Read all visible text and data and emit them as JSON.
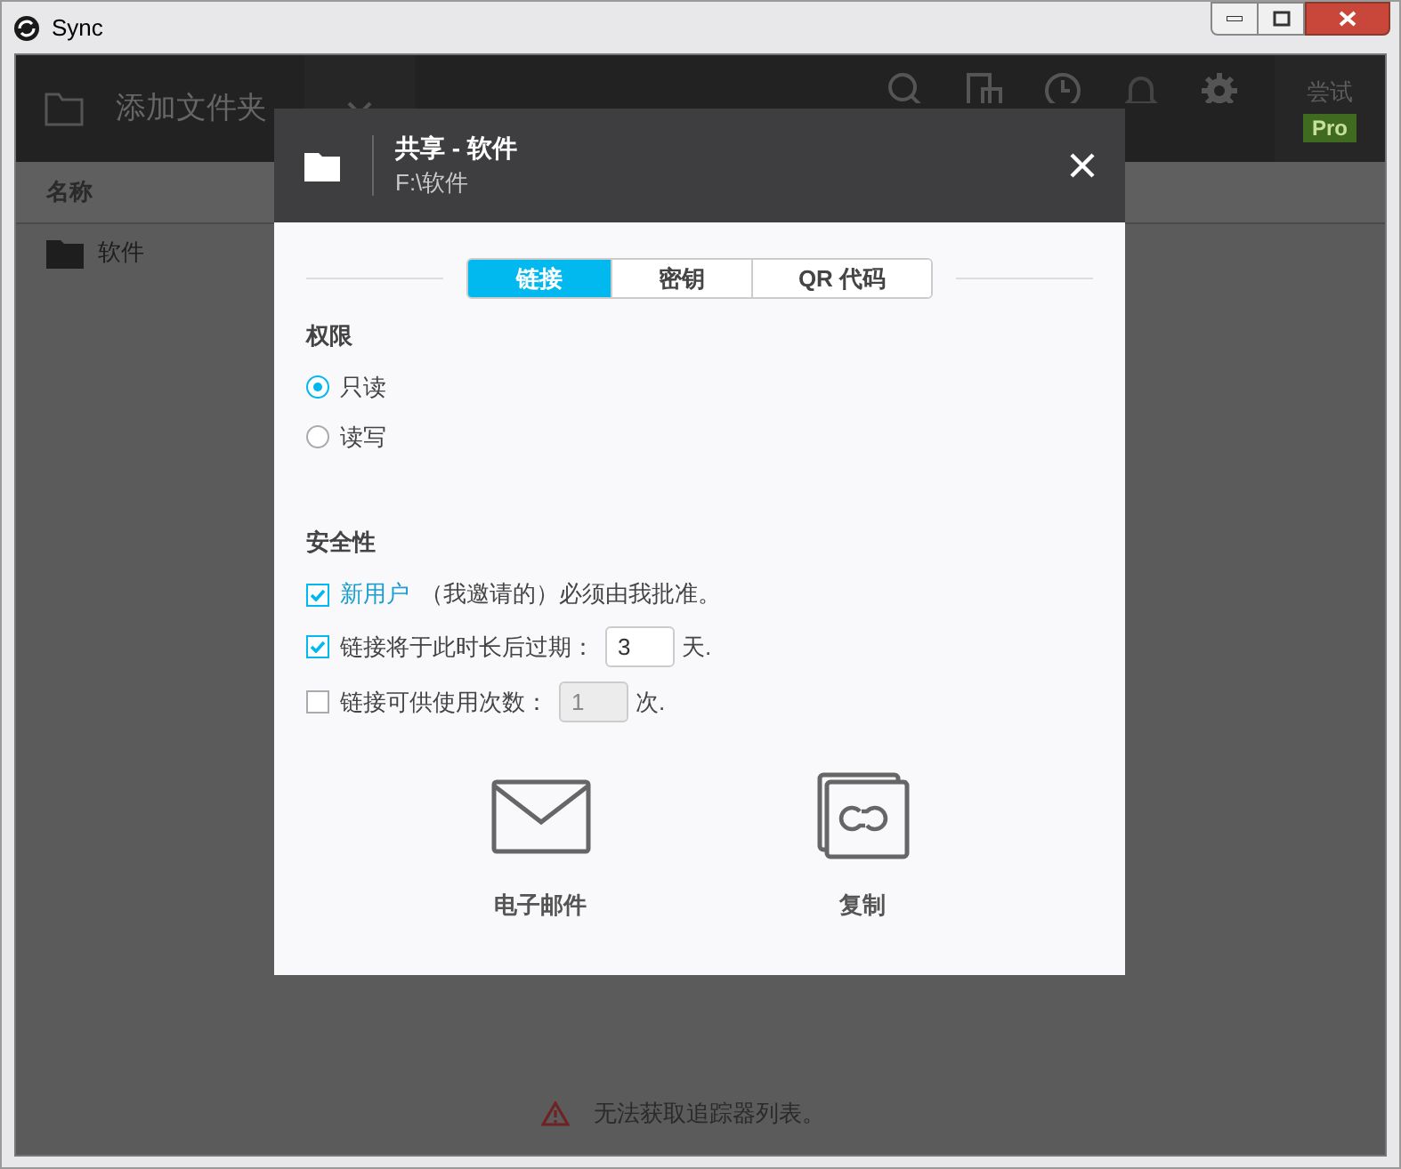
{
  "window": {
    "title": "Sync"
  },
  "toolbar": {
    "add_folder": "添加文件夹",
    "trial": "尝试",
    "pro_badge": "Pro"
  },
  "list": {
    "header": "名称",
    "rows": [
      {
        "name": "软件"
      }
    ]
  },
  "dialog": {
    "title": "共享 - 软件",
    "path": "F:\\软件",
    "tabs": [
      {
        "label": "链接",
        "selected": true
      },
      {
        "label": "密钥",
        "selected": false
      },
      {
        "label": "QR 代码",
        "selected": false
      }
    ],
    "permissions": {
      "heading": "权限",
      "options": [
        {
          "label": "只读",
          "selected": true
        },
        {
          "label": "读写",
          "selected": false
        }
      ]
    },
    "security": {
      "heading": "安全性",
      "options": [
        {
          "kind": "approval",
          "link": "新用户",
          "text": "（我邀请的）必须由我批准。",
          "checked": true
        },
        {
          "kind": "expiry",
          "text": "链接将于此时长后过期：",
          "value": "3",
          "unit": "天.",
          "checked": true
        },
        {
          "kind": "uses",
          "text": "链接可供使用次数：",
          "value": "1",
          "unit": "次.",
          "checked": false
        }
      ]
    },
    "actions": [
      {
        "kind": "email",
        "label": "电子邮件"
      },
      {
        "kind": "copy",
        "label": "复制"
      }
    ]
  },
  "status_bar": {
    "message": "无法获取追踪器列表。"
  }
}
